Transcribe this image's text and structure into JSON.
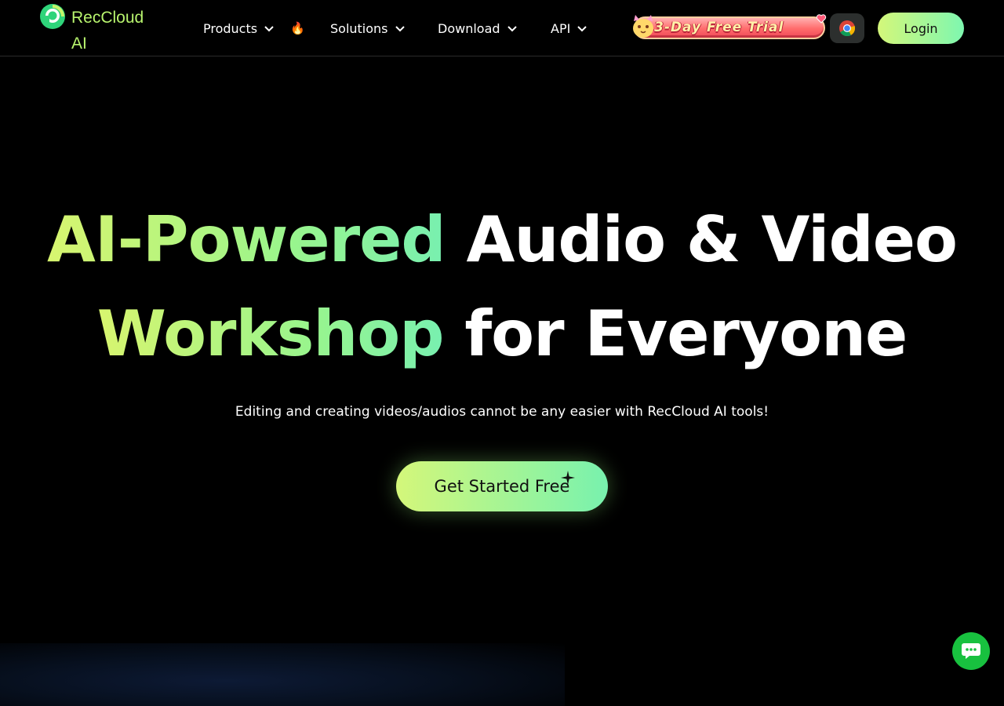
{
  "brand": {
    "name": "RecCloud AI",
    "logo_icon": "reccloud-logo-icon",
    "accent": "#b8f46e"
  },
  "nav": {
    "items": [
      {
        "label": "Products",
        "icon": "chevron-down-icon",
        "badge": "fire-icon"
      },
      {
        "label": "Solutions",
        "icon": "chevron-down-icon"
      },
      {
        "label": "Download",
        "icon": "chevron-down-icon"
      },
      {
        "label": "API",
        "icon": "chevron-down-icon"
      }
    ]
  },
  "header": {
    "trial_badge": "3-Day Free Trial",
    "chrome_icon": "chrome-icon",
    "login_label": "Login"
  },
  "hero": {
    "line1_highlight": "AI-Powered",
    "line1_rest": "Audio & Video",
    "line2_highlight": "Workshop",
    "line2_rest": "for Everyone",
    "subtitle": "Editing and creating videos/audios cannot be any easier with RecCloud AI tools!",
    "cta_label": "Get Started Free",
    "cta_icon": "sparkle-icon"
  },
  "support": {
    "chat_icon": "chat-icon"
  },
  "colors": {
    "gradient_start": "#d4f77a",
    "gradient_end": "#78f2ae",
    "background": "#000000",
    "chat_green": "#18c13f"
  }
}
